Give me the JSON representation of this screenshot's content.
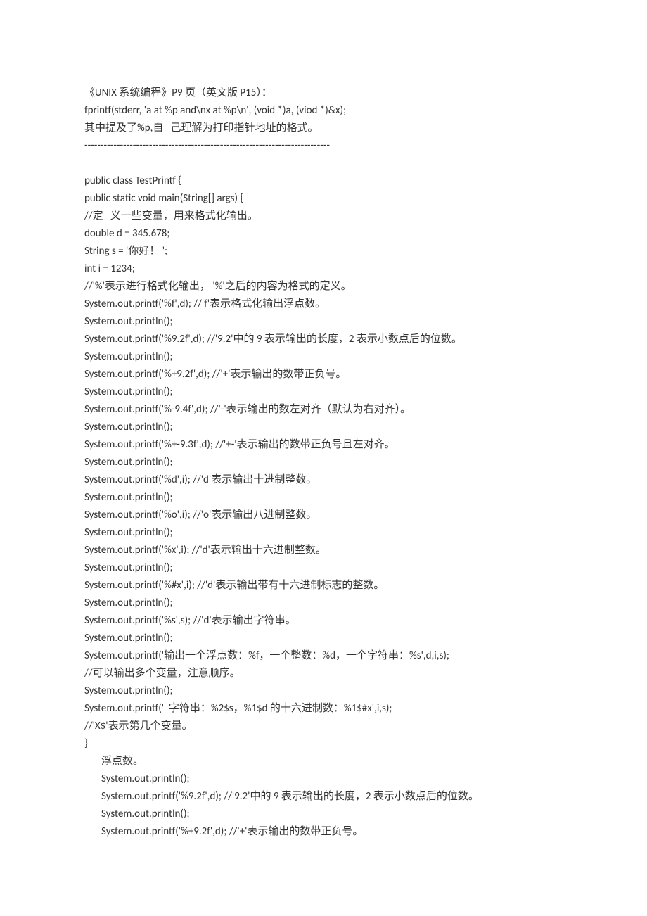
{
  "lines": [
    {
      "text": "《UNIX 系统编程》P9 页（英文版 P15）：",
      "indent": false
    },
    {
      "text": "fprintf(stderr, 'a at %p and\\nx at %p\\n', (void *)a, (viod *)&x);",
      "indent": false
    },
    {
      "text": "其中提及了%p,自   己理解为打印指针地址的格式。",
      "indent": false
    },
    {
      "text": "----------------------------------------------------------------------------",
      "indent": false
    },
    {
      "text": "",
      "indent": false
    },
    {
      "text": "public class TestPrintf {",
      "indent": false
    },
    {
      "text": "public static void main(String[] args) {",
      "indent": false
    },
    {
      "text": "//定   义一些变量，用来格式化输出。",
      "indent": false
    },
    {
      "text": "double d = 345.678;",
      "indent": false
    },
    {
      "text": "String s = '你好！ ';",
      "indent": false
    },
    {
      "text": "int i = 1234;",
      "indent": false
    },
    {
      "text": "//'%'表示进行格式化输出， '%'之后的内容为格式的定义。",
      "indent": false
    },
    {
      "text": "System.out.printf('%f',d); //'f'表示格式化输出浮点数。",
      "indent": false
    },
    {
      "text": "System.out.println();",
      "indent": false
    },
    {
      "text": "System.out.printf('%9.2f',d); //'9.2'中的 9 表示输出的长度，2 表示小数点后的位数。",
      "indent": false
    },
    {
      "text": "System.out.println();",
      "indent": false
    },
    {
      "text": "System.out.printf('%+9.2f',d); //'+'表示输出的数带正负号。",
      "indent": false
    },
    {
      "text": "System.out.println();",
      "indent": false
    },
    {
      "text": "System.out.printf('%-9.4f',d); //'-'表示输出的数左对齐（默认为右对齐）。",
      "indent": false
    },
    {
      "text": "System.out.println();",
      "indent": false
    },
    {
      "text": "System.out.printf('%+-9.3f',d); //'+-'表示输出的数带正负号且左对齐。",
      "indent": false
    },
    {
      "text": "System.out.println();",
      "indent": false
    },
    {
      "text": "System.out.printf('%d',i); //'d'表示输出十进制整数。",
      "indent": false
    },
    {
      "text": "System.out.println();",
      "indent": false
    },
    {
      "text": "System.out.printf('%o',i); //'o'表示输出八进制整数。",
      "indent": false
    },
    {
      "text": "System.out.println();",
      "indent": false
    },
    {
      "text": "System.out.printf('%x',i); //'d'表示输出十六进制整数。",
      "indent": false
    },
    {
      "text": "System.out.println();",
      "indent": false
    },
    {
      "text": "System.out.printf('%#x',i); //'d'表示输出带有十六进制标志的整数。",
      "indent": false
    },
    {
      "text": "System.out.println();",
      "indent": false
    },
    {
      "text": "System.out.printf('%s',s); //'d'表示输出字符串。",
      "indent": false
    },
    {
      "text": "System.out.println();",
      "indent": false
    },
    {
      "text": "System.out.printf('输出一个浮点数：%f，一个整数：%d，一个字符串：%s',d,i,s);",
      "indent": false
    },
    {
      "text": "//可以输出多个变量，注意顺序。",
      "indent": false
    },
    {
      "text": "System.out.println();",
      "indent": false
    },
    {
      "text": "System.out.printf('  字符串：%2$s，%1$d 的十六进制数：%1$#x',i,s);",
      "indent": false
    },
    {
      "text": "//'X$'表示第几个变量。",
      "indent": false
    },
    {
      "text": "}",
      "indent": false
    },
    {
      "text": "浮点数。",
      "indent": true
    },
    {
      "text": "System.out.println();",
      "indent": true
    },
    {
      "text": "System.out.printf('%9.2f',d); //'9.2'中的 9 表示输出的长度，2 表示小数点后的位数。",
      "indent": true
    },
    {
      "text": "System.out.println();",
      "indent": true
    },
    {
      "text": "System.out.printf('%+9.2f',d); //'+'表示输出的数带正负号。",
      "indent": true
    }
  ]
}
